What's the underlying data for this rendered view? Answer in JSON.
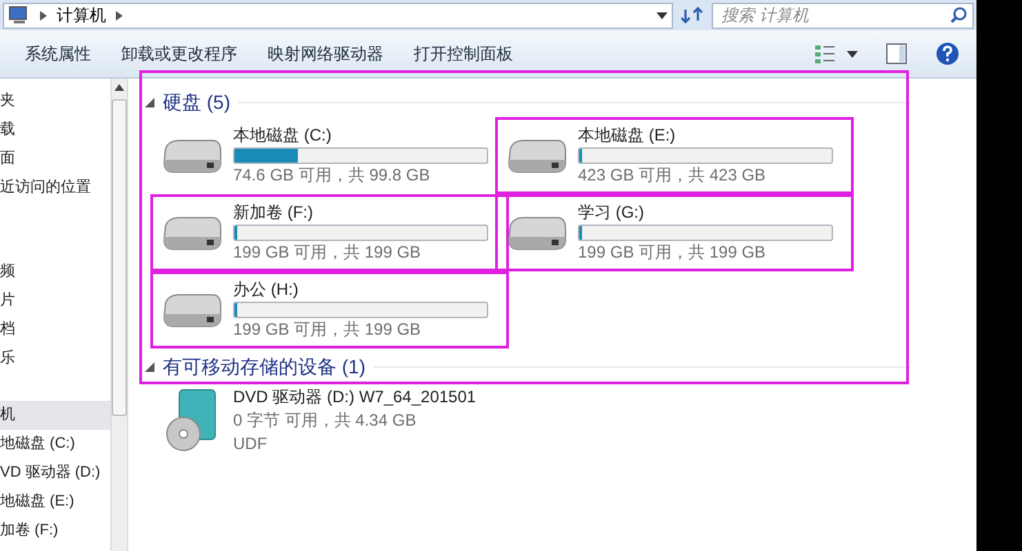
{
  "address": {
    "path": "计算机"
  },
  "search": {
    "placeholder": "搜索 计算机"
  },
  "toolbar": {
    "buttons": [
      "系统属性",
      "卸载或更改程序",
      "映射网络驱动器",
      "打开控制面板"
    ]
  },
  "nav": {
    "items": [
      {
        "label": "夹",
        "selected": false
      },
      {
        "label": "载",
        "selected": false
      },
      {
        "label": "面",
        "selected": false
      },
      {
        "label": "近访问的位置",
        "selected": false
      },
      {
        "label": "频",
        "selected": false
      },
      {
        "label": "片",
        "selected": false
      },
      {
        "label": "档",
        "selected": false
      },
      {
        "label": "乐",
        "selected": false
      },
      {
        "label": "机",
        "selected": true
      },
      {
        "label": "地磁盘 (C:)",
        "selected": false
      },
      {
        "label": "VD 驱动器 (D:)",
        "selected": false
      },
      {
        "label": "地磁盘 (E:)",
        "selected": false
      },
      {
        "label": "加卷 (F:)",
        "selected": false
      }
    ]
  },
  "annotation": {
    "group_frame": true
  },
  "groups": [
    {
      "title": "硬盘 (5)",
      "expanded": true,
      "drives": [
        {
          "kind": "hdd",
          "name": "本地磁盘 (C:)",
          "level": 0.25,
          "info": "74.6 GB 可用，共 99.8 GB",
          "highlighted": false
        },
        {
          "kind": "hdd",
          "name": "本地磁盘 (E:)",
          "level": 0.01,
          "info": "423 GB 可用，共 423 GB",
          "highlighted": true
        },
        {
          "kind": "hdd",
          "name": "新加卷 (F:)",
          "level": 0.01,
          "info": "199 GB 可用，共 199 GB",
          "highlighted": true
        },
        {
          "kind": "hdd",
          "name": "学习 (G:)",
          "level": 0.01,
          "info": "199 GB 可用，共 199 GB",
          "highlighted": true
        },
        {
          "kind": "hdd",
          "name": "办公 (H:)",
          "level": 0.01,
          "info": "199 GB 可用，共 199 GB",
          "highlighted": true
        }
      ]
    },
    {
      "title": "有可移动存储的设备 (1)",
      "expanded": true,
      "drives": [
        {
          "kind": "dvd",
          "name": "DVD 驱动器 (D:) W7_64_201501",
          "info": "0 字节 可用，共 4.34 GB",
          "filesystem": "UDF",
          "highlighted": false
        }
      ]
    }
  ]
}
